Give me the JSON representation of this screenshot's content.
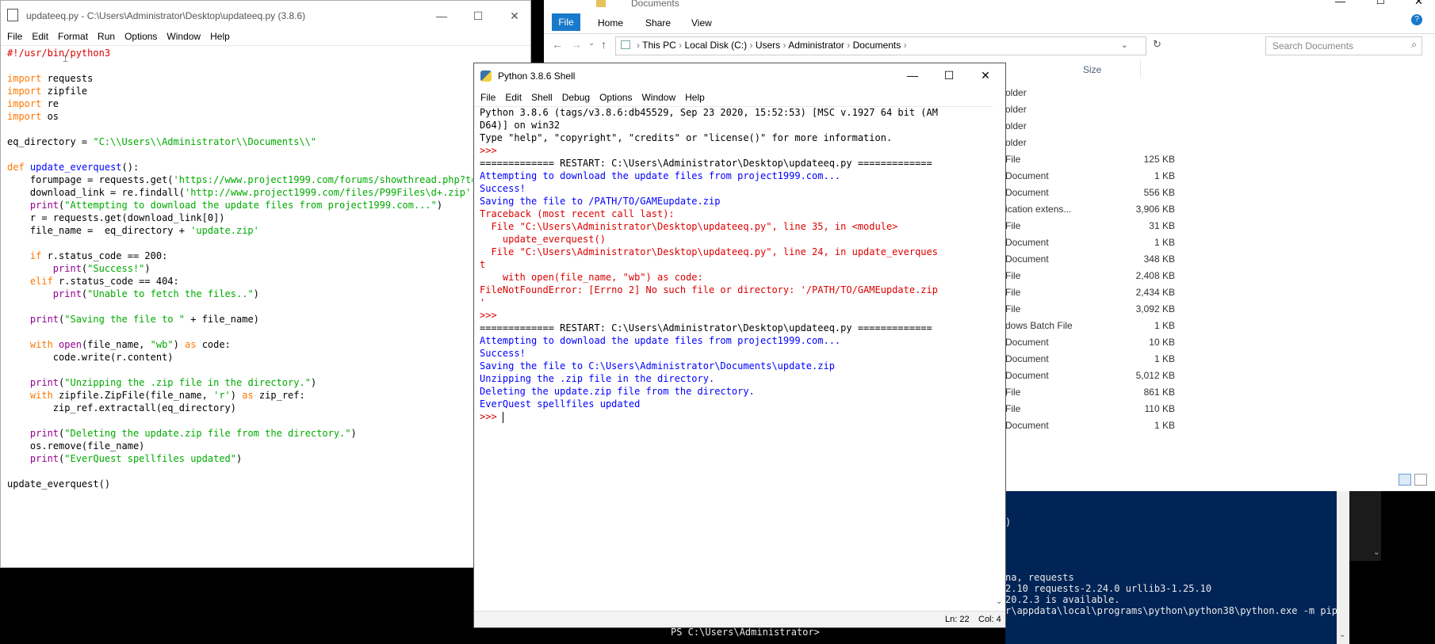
{
  "explorer": {
    "title": "Documents",
    "ribbon_tabs": [
      "File",
      "Home",
      "Share",
      "View"
    ],
    "breadcrumb": [
      "This PC",
      "Local Disk (C:)",
      "Users",
      "Administrator",
      "Documents"
    ],
    "search_placeholder": "Search Documents",
    "size_header": "Size",
    "rows": [
      {
        "type": "older",
        "size": ""
      },
      {
        "type": "older",
        "size": ""
      },
      {
        "type": "older",
        "size": ""
      },
      {
        "type": "older",
        "size": ""
      },
      {
        "type": "File",
        "size": "125 KB"
      },
      {
        "type": "Document",
        "size": "1 KB"
      },
      {
        "type": "Document",
        "size": "556 KB"
      },
      {
        "type": "ication extens...",
        "size": "3,906 KB"
      },
      {
        "type": "File",
        "size": "31 KB"
      },
      {
        "type": "Document",
        "size": "1 KB"
      },
      {
        "type": "Document",
        "size": "348 KB"
      },
      {
        "type": "File",
        "size": "2,408 KB"
      },
      {
        "type": "File",
        "size": "2,434 KB"
      },
      {
        "type": "File",
        "size": "3,092 KB"
      },
      {
        "type": "dows Batch File",
        "size": "1 KB"
      },
      {
        "type": "Document",
        "size": "10 KB"
      },
      {
        "type": "Document",
        "size": "1 KB"
      },
      {
        "type": "Document",
        "size": "5,012 KB"
      },
      {
        "type": "File",
        "size": "861 KB"
      },
      {
        "type": "File",
        "size": "110 KB"
      },
      {
        "type": "Document",
        "size": "1 KB"
      }
    ]
  },
  "powershell": {
    "lines": [
      ")",
      "na, requests",
      "2.10 requests-2.24.0 urllib3-1.25.10",
      "20.2.3 is available.",
      "r\\appdata\\local\\programs\\python\\python38\\python.exe -m pip i",
      "PS C:\\Users\\Administrator>"
    ]
  },
  "editor": {
    "title": "updateeq.py - C:\\Users\\Administrator\\Desktop\\updateeq.py (3.8.6)",
    "menu": [
      "File",
      "Edit",
      "Format",
      "Run",
      "Options",
      "Window",
      "Help"
    ]
  },
  "shell": {
    "title": "Python 3.8.6 Shell",
    "menu": [
      "File",
      "Edit",
      "Shell",
      "Debug",
      "Options",
      "Window",
      "Help"
    ],
    "status": {
      "line": "Ln: 22",
      "col": "Col: 4"
    }
  }
}
